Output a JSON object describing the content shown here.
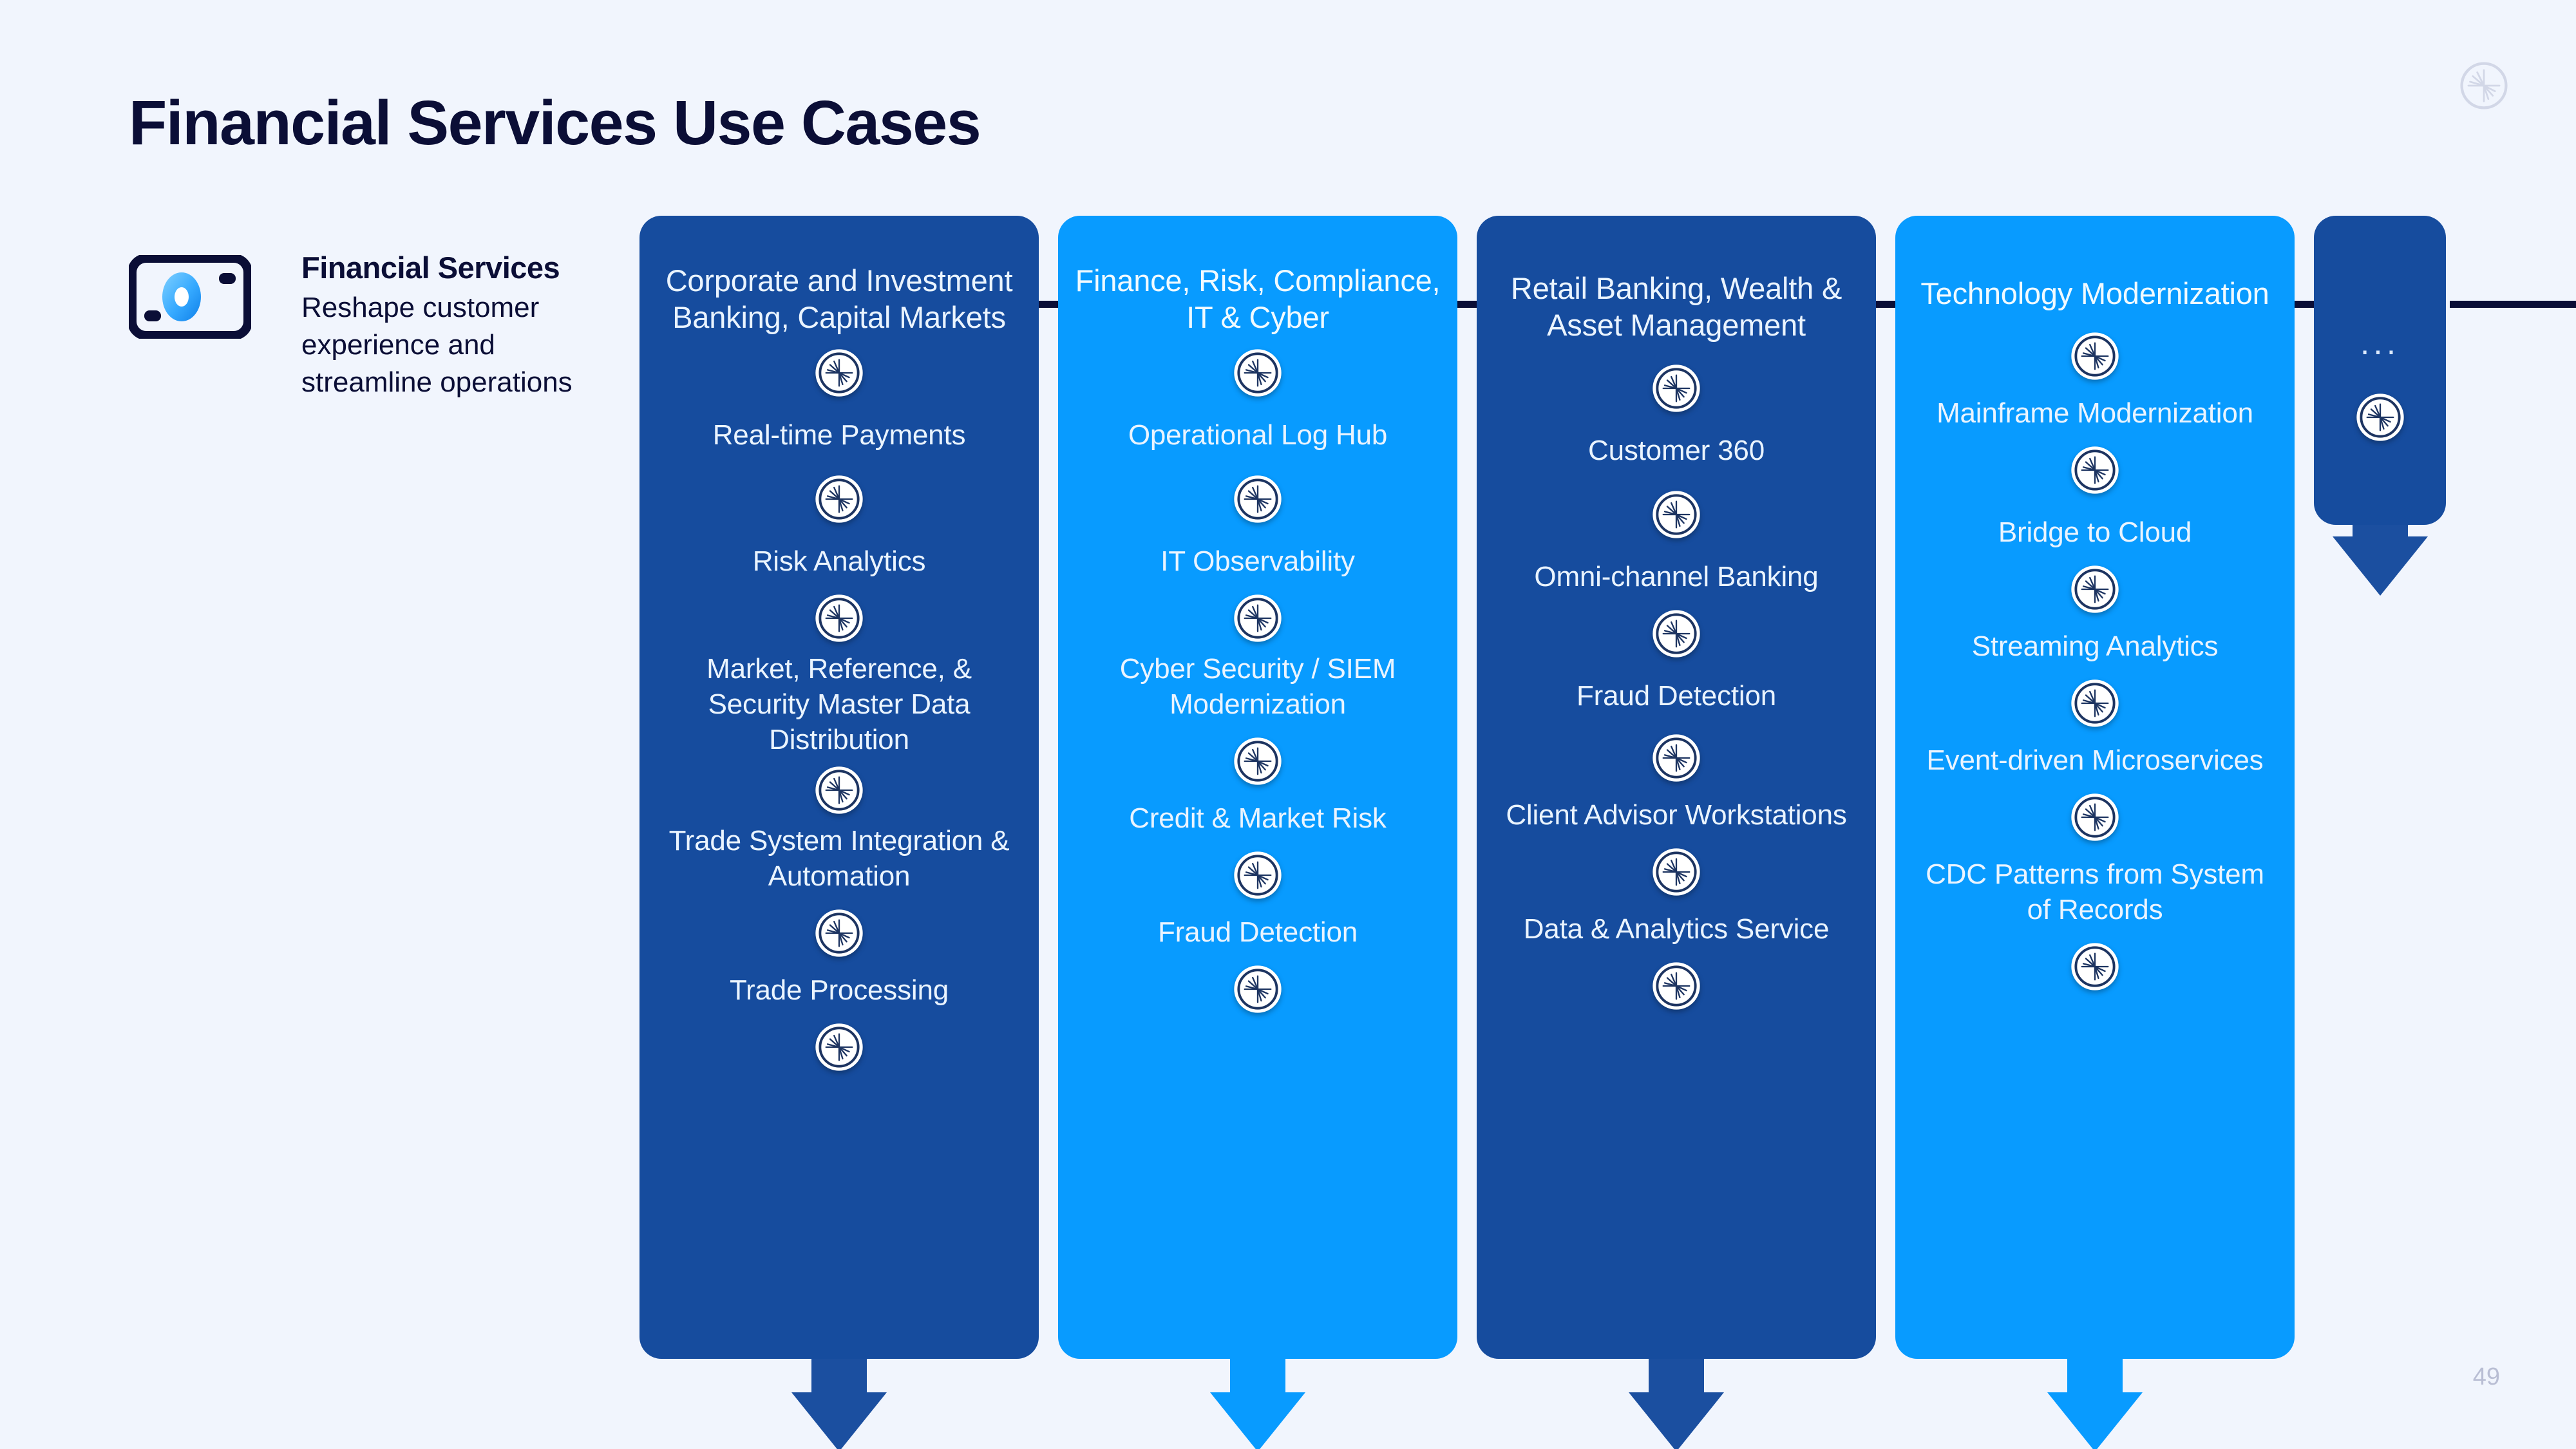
{
  "page": {
    "title": "Financial Services Use Cases",
    "number": "49",
    "background_color": "#f1f5fd",
    "brand_logo": "confluent-starburst-logo"
  },
  "legend": {
    "icon": "presentation-screen-icon",
    "title": "Financial Services",
    "description": "Reshape customer experience and streamline operations"
  },
  "flow": {
    "horizontal_arrow": "right-arrow",
    "colors": {
      "dark_blue": "#164c9e",
      "light_blue": "#089bff",
      "navy": "#0b0e36"
    }
  },
  "columns": [
    {
      "header": "Corporate and Investment Banking, Capital Markets",
      "theme": "dark",
      "items": [
        "Real-time Payments",
        "Risk Analytics",
        "Market, Reference, & Security Master Data Distribution",
        "Trade System Integration & Automation",
        "Trade Processing"
      ],
      "arrow": "down-arrow"
    },
    {
      "header": "Finance, Risk, Compliance, IT & Cyber",
      "theme": "light",
      "items": [
        "Operational Log Hub",
        "IT Observability",
        "Cyber Security / SIEM Modernization",
        "Credit & Market Risk",
        "Fraud Detection"
      ],
      "arrow": "down-arrow"
    },
    {
      "header": "Retail Banking, Wealth & Asset Management",
      "theme": "dark",
      "items": [
        "Customer 360",
        "Omni-channel Banking",
        "Fraud Detection",
        "Client Advisor Workstations",
        "Data & Analytics Service"
      ],
      "arrow": "down-arrow"
    },
    {
      "header": "Technology Modernization",
      "theme": "light",
      "items": [
        "Mainframe Modernization",
        "Bridge to Cloud",
        "Streaming Analytics",
        "Event-driven Microservices",
        "CDC Patterns from System of Records"
      ],
      "arrow": "down-arrow"
    }
  ],
  "more_column": {
    "theme": "dark",
    "label": "...",
    "icon": "starburst-node-icon",
    "arrow": "down-arrow"
  }
}
